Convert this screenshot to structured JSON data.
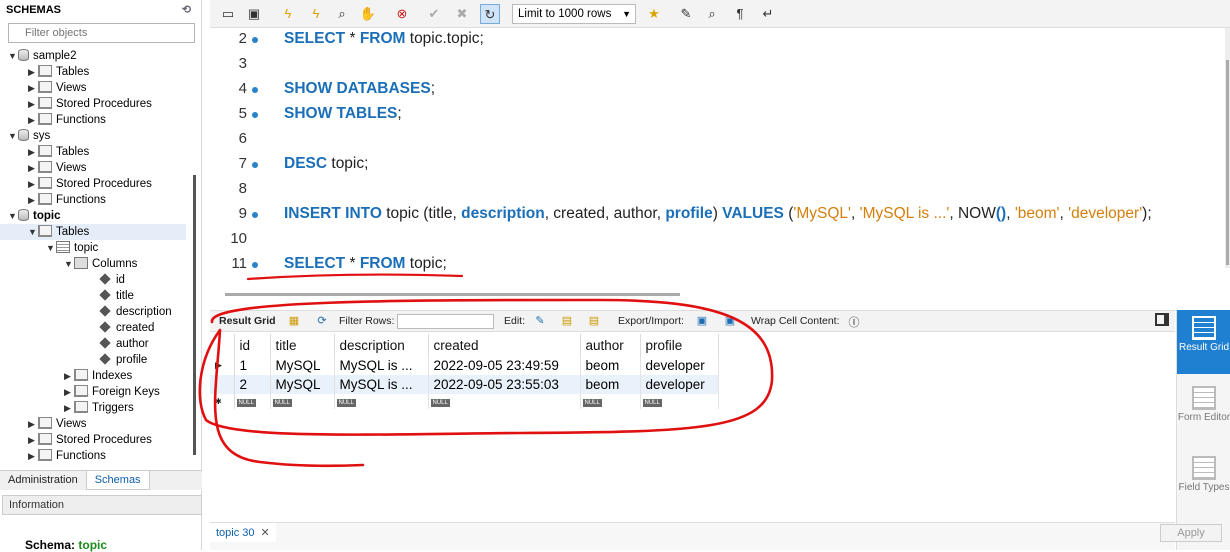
{
  "left_panel": {
    "header": "SCHEMAS",
    "filter_placeholder": "Filter objects",
    "tree": [
      {
        "label": "sample2",
        "depth": 0,
        "type": "db",
        "expanded": true
      },
      {
        "label": "Tables",
        "depth": 1,
        "type": "folder"
      },
      {
        "label": "Views",
        "depth": 1,
        "type": "folder"
      },
      {
        "label": "Stored Procedures",
        "depth": 1,
        "type": "folder"
      },
      {
        "label": "Functions",
        "depth": 1,
        "type": "folder"
      },
      {
        "label": "sys",
        "depth": 0,
        "type": "db",
        "expanded": true
      },
      {
        "label": "Tables",
        "depth": 1,
        "type": "folder"
      },
      {
        "label": "Views",
        "depth": 1,
        "type": "folder"
      },
      {
        "label": "Stored Procedures",
        "depth": 1,
        "type": "folder"
      },
      {
        "label": "Functions",
        "depth": 1,
        "type": "folder"
      },
      {
        "label": "topic",
        "depth": 0,
        "type": "db",
        "expanded": true,
        "bold": true
      },
      {
        "label": "Tables",
        "depth": 1,
        "type": "folder",
        "expanded": true,
        "selected": true
      },
      {
        "label": "topic",
        "depth": 2,
        "type": "table",
        "expanded": true
      },
      {
        "label": "Columns",
        "depth": 3,
        "type": "columns",
        "expanded": true
      },
      {
        "label": "id",
        "depth": 4,
        "type": "col"
      },
      {
        "label": "title",
        "depth": 4,
        "type": "col"
      },
      {
        "label": "description",
        "depth": 4,
        "type": "col"
      },
      {
        "label": "created",
        "depth": 4,
        "type": "col"
      },
      {
        "label": "author",
        "depth": 4,
        "type": "col"
      },
      {
        "label": "profile",
        "depth": 4,
        "type": "col"
      },
      {
        "label": "Indexes",
        "depth": 3,
        "type": "folder"
      },
      {
        "label": "Foreign Keys",
        "depth": 3,
        "type": "folder"
      },
      {
        "label": "Triggers",
        "depth": 3,
        "type": "folder"
      },
      {
        "label": "Views",
        "depth": 1,
        "type": "folder"
      },
      {
        "label": "Stored Procedures",
        "depth": 1,
        "type": "folder"
      },
      {
        "label": "Functions",
        "depth": 1,
        "type": "folder"
      }
    ],
    "tabs": {
      "administration": "Administration",
      "schemas": "Schemas"
    },
    "info_header": "Information",
    "schema_label": "Schema:",
    "schema_value": "topic"
  },
  "toolbar": {
    "limit_label": "Limit to 1000 rows",
    "icons": [
      "open-folder-icon",
      "save-icon",
      "execute-icon",
      "execute-current-icon",
      "explain-icon",
      "stop-icon",
      "toggle-error-icon",
      "commit-icon",
      "rollback-icon",
      "autocommit-icon",
      "star-icon",
      "beautify-icon",
      "find-icon",
      "invisible-chars-icon",
      "wrap-icon"
    ]
  },
  "editor": {
    "lines": [
      {
        "n": "2",
        "dot": true,
        "parts": [
          [
            "kw",
            "SELECT"
          ],
          [
            "t",
            " * "
          ],
          [
            "kw",
            "FROM"
          ],
          [
            "t",
            " topic.topic;"
          ]
        ]
      },
      {
        "n": "3",
        "dot": false,
        "parts": []
      },
      {
        "n": "4",
        "dot": true,
        "parts": [
          [
            "kw",
            "SHOW DATABASES"
          ],
          [
            "t",
            ";"
          ]
        ]
      },
      {
        "n": "5",
        "dot": true,
        "parts": [
          [
            "kw",
            "SHOW TABLES"
          ],
          [
            "t",
            ";"
          ]
        ]
      },
      {
        "n": "6",
        "dot": false,
        "parts": []
      },
      {
        "n": "7",
        "dot": true,
        "parts": [
          [
            "kw",
            "DESC"
          ],
          [
            "t",
            " topic;"
          ]
        ]
      },
      {
        "n": "8",
        "dot": false,
        "parts": []
      },
      {
        "n": "9",
        "dot": true,
        "parts": [
          [
            "kw",
            "INSERT INTO"
          ],
          [
            "t",
            " topic (title, "
          ],
          [
            "kw",
            "description"
          ],
          [
            "t",
            ", created, author, "
          ],
          [
            "kw",
            "profile"
          ],
          [
            "t",
            ") "
          ],
          [
            "kw",
            "VALUES"
          ],
          [
            "t",
            " ("
          ],
          [
            "str",
            "'MySQL'"
          ],
          [
            "t",
            ", "
          ],
          [
            "str",
            "'MySQL is ...'"
          ],
          [
            "t",
            ", "
          ],
          [
            "t",
            "NOW"
          ],
          [
            "kw",
            "()"
          ],
          [
            "t",
            ", "
          ],
          [
            "str",
            "'beom'"
          ],
          [
            "t",
            ", "
          ],
          [
            "str",
            "'developer'"
          ],
          [
            "t",
            ");"
          ]
        ]
      },
      {
        "n": "10",
        "dot": false,
        "parts": []
      },
      {
        "n": "11",
        "dot": true,
        "parts": [
          [
            "kw",
            "SELECT"
          ],
          [
            "t",
            " * "
          ],
          [
            "kw",
            "FROM"
          ],
          [
            "t",
            " topic;"
          ]
        ]
      }
    ]
  },
  "result_toolbar": {
    "result_grid": "Result Grid",
    "filter_rows": "Filter Rows:",
    "edit": "Edit:",
    "export_import": "Export/Import:",
    "wrap": "Wrap Cell Content:"
  },
  "grid": {
    "columns": [
      "id",
      "title",
      "description",
      "created",
      "author",
      "profile"
    ],
    "rows": [
      [
        "1",
        "MySQL",
        "MySQL is ...",
        "2022-09-05 23:49:59",
        "beom",
        "developer"
      ],
      [
        "2",
        "MySQL",
        "MySQL is ...",
        "2022-09-05 23:55:03",
        "beom",
        "developer"
      ]
    ],
    "null_label": "NULL"
  },
  "right_panel": {
    "result_grid": "Result Grid",
    "form_editor": "Form Editor",
    "field_types": "Field Types"
  },
  "bottom": {
    "tab_label": "topic 30",
    "apply": "Apply"
  },
  "colors": {
    "accent": "#1f7fd0",
    "annotation": "#e01010",
    "keyword": "#1a6fb8",
    "string": "#d47f0c"
  }
}
